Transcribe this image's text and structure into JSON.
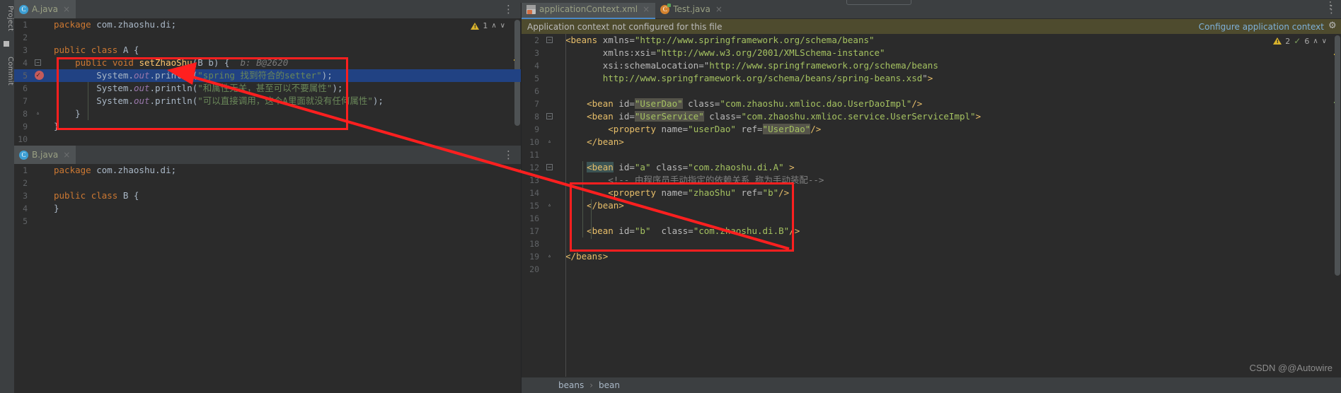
{
  "app": {
    "ide": "IntelliJ IDEA",
    "watermark": "CSDN @@Autowire",
    "accent_red": "#ff1f1f",
    "accent_blue": "#4a88c7",
    "banner_bg": "#4e4b2e"
  },
  "left_toolbar": {
    "items": [
      {
        "label": "Project",
        "name": "tool-window-project"
      },
      {
        "label": "Commit",
        "name": "tool-window-commit"
      }
    ]
  },
  "left_panel": {
    "tabs": [
      {
        "label": "A.java",
        "icon": "java-class-icon",
        "icon_letter": "C",
        "active": true,
        "close": "×"
      }
    ],
    "second_tabs": [
      {
        "label": "B.java",
        "icon": "java-class-icon",
        "icon_letter": "C",
        "active": true,
        "close": "×"
      }
    ],
    "inspection": {
      "warning_icon": "warning-triangle-icon",
      "warning_count": "1",
      "up": "∧",
      "down": "∨"
    },
    "inspection_b": {
      "ok_icon": "check-icon",
      "glyph": "✓"
    },
    "editor_a": {
      "lines": [
        {
          "num": "1",
          "text": "package com.zhaoshu.di;"
        },
        {
          "num": "2",
          "text": ""
        },
        {
          "num": "3",
          "text": "public class A {"
        },
        {
          "num": "4",
          "text": "    public void setZhaoShu(B b) {",
          "hint": "b: B@2620",
          "fold": "−"
        },
        {
          "num": "5",
          "text": "        System.out.println(\"spring 找到符合的setter\");",
          "highlighted": true,
          "breakpoint": "breakpoint-verified-icon"
        },
        {
          "num": "6",
          "text": "        System.out.println(\"和属性无关，甚至可以不要属性\");"
        },
        {
          "num": "7",
          "text": "        System.out.println(\"可以直接调用，这个A里面就没有任何属性\");"
        },
        {
          "num": "8",
          "text": "    }",
          "fold": "▵"
        },
        {
          "num": "9",
          "text": "}"
        },
        {
          "num": "10",
          "text": ""
        }
      ]
    },
    "editor_b": {
      "lines": [
        {
          "num": "1",
          "text": "package com.zhaoshu.di;"
        },
        {
          "num": "2",
          "text": ""
        },
        {
          "num": "3",
          "text": "public class B {"
        },
        {
          "num": "4",
          "text": "}"
        },
        {
          "num": "5",
          "text": ""
        }
      ]
    }
  },
  "right_panel": {
    "tabs": [
      {
        "label": "applicationContext.xml",
        "icon": "xml-spring-file-icon",
        "active": true,
        "close": "×"
      },
      {
        "label": "Test.java",
        "icon": "java-test-class-icon",
        "icon_letter": "C",
        "active": false,
        "close": "×"
      }
    ],
    "banner": {
      "message": "Application context not configured for this file",
      "action": "Configure application context",
      "gear": "gear-icon"
    },
    "inspection": {
      "warning_icon": "warning-triangle-icon",
      "warning_count": "2",
      "weak_icon": "weak-warning-icon",
      "weak_count": "6",
      "up": "∧",
      "down": "∨"
    },
    "editor_xml": {
      "lines": [
        {
          "num": "2",
          "text": "<beans xmlns=\"http://www.springframework.org/schema/beans\"",
          "fold": "−"
        },
        {
          "num": "3",
          "text": "       xmlns:xsi=\"http://www.w3.org/2001/XMLSchema-instance\""
        },
        {
          "num": "4",
          "text": "       xsi:schemaLocation=\"http://www.springframework.org/schema/beans"
        },
        {
          "num": "5",
          "text": "       http://www.springframework.org/schema/beans/spring-beans.xsd\">"
        },
        {
          "num": "6",
          "text": ""
        },
        {
          "num": "7",
          "text": "    <bean id=\"UserDao\" class=\"com.zhaoshu.xmlioc.dao.UserDaoImpl\"/>"
        },
        {
          "num": "8",
          "text": "    <bean id=\"UserService\" class=\"com.zhaoshu.xmlioc.service.UserServiceImpl\">",
          "fold": "−"
        },
        {
          "num": "9",
          "text": "        <property name=\"userDao\" ref=\"UserDao\"/>"
        },
        {
          "num": "10",
          "text": "    </bean>",
          "fold": "▵"
        },
        {
          "num": "11",
          "text": ""
        },
        {
          "num": "12",
          "text": "    <bean id=\"a\" class=\"com.zhaoshu.di.A\" >",
          "fold": "−"
        },
        {
          "num": "13",
          "text": "        <!-- 由程序员手动指定的依赖关系 称为手动装配-->"
        },
        {
          "num": "14",
          "text": "        <property name=\"zhaoShu\" ref=\"b\"/>"
        },
        {
          "num": "15",
          "text": "    </bean>",
          "fold": "▵"
        },
        {
          "num": "16",
          "text": ""
        },
        {
          "num": "17",
          "text": "    <bean id=\"b\"  class=\"com.zhaoshu.di.B\"/>"
        },
        {
          "num": "18",
          "text": ""
        },
        {
          "num": "19",
          "text": "</beans>",
          "fold": "▵"
        },
        {
          "num": "20",
          "text": ""
        }
      ]
    },
    "breadcrumb": {
      "items": [
        "beans",
        "bean"
      ],
      "separator": "›"
    }
  }
}
